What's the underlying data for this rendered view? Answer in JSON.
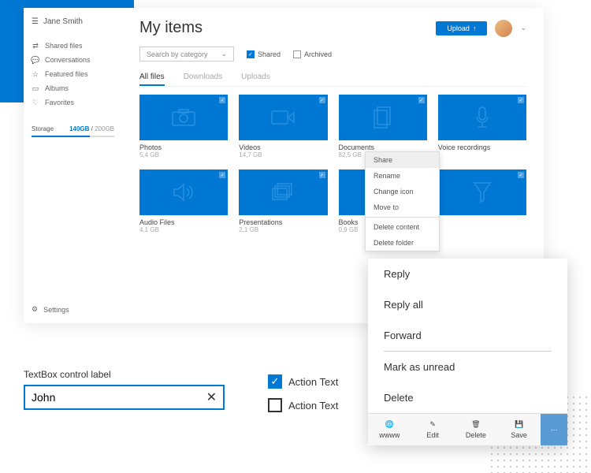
{
  "user": {
    "name": "Jane Smith"
  },
  "sidebar": {
    "items": [
      {
        "icon": "share",
        "label": "Shared files"
      },
      {
        "icon": "chat",
        "label": "Conversations"
      },
      {
        "icon": "star",
        "label": "Featured files"
      },
      {
        "icon": "album",
        "label": "Albums"
      },
      {
        "icon": "heart",
        "label": "Favorites"
      }
    ],
    "storage": {
      "label": "Storage",
      "used": "140GB",
      "total": "200GB"
    },
    "settings": "Settings"
  },
  "header": {
    "title": "My items",
    "upload": "Upload"
  },
  "filters": {
    "category_placeholder": "Search by category",
    "shared": {
      "label": "Shared",
      "checked": true
    },
    "archived": {
      "label": "Archived",
      "checked": false
    }
  },
  "tabs": [
    "All files",
    "Downloads",
    "Uploads"
  ],
  "cards": [
    {
      "name": "Photos",
      "size": "5,4 GB",
      "icon": "camera"
    },
    {
      "name": "Videos",
      "size": "14,7 GB",
      "icon": "video"
    },
    {
      "name": "Documents",
      "size": "82,5 GB",
      "icon": "doc"
    },
    {
      "name": "Voice recordings",
      "size": "",
      "icon": "mic"
    },
    {
      "name": "Audio Files",
      "size": "4,1 GB",
      "icon": "speaker"
    },
    {
      "name": "Presentations",
      "size": "2,1 GB",
      "icon": "stack"
    },
    {
      "name": "Books",
      "size": "0,9 GB",
      "icon": "book"
    },
    {
      "name": "",
      "size": "",
      "icon": "funnel"
    }
  ],
  "context_menu": [
    "Share",
    "Rename",
    "Change icon",
    "Move to",
    "Delete content",
    "Delete folder"
  ],
  "action_menu": {
    "items": [
      "Reply",
      "Reply all",
      "Forward",
      "Mark as unread",
      "Delete"
    ],
    "toolbar": [
      {
        "label": "wwww",
        "icon": "globe"
      },
      {
        "label": "Edit",
        "icon": "pencil"
      },
      {
        "label": "Delete",
        "icon": "trash"
      },
      {
        "label": "Save",
        "icon": "save"
      }
    ]
  },
  "textbox": {
    "label": "TextBox control label",
    "value": "John"
  },
  "checks": [
    {
      "label": "Action Text",
      "checked": true
    },
    {
      "label": "Action Text",
      "checked": false
    }
  ]
}
